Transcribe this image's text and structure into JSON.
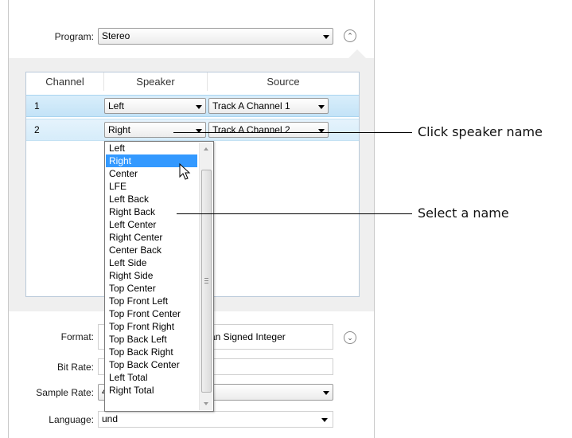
{
  "program": {
    "label": "Program:",
    "value": "Stereo",
    "collapse_icon": "chevron-up-icon"
  },
  "mapping": {
    "headers": [
      "Channel",
      "Speaker",
      "Source"
    ],
    "rows": [
      {
        "channel": "1",
        "speaker": "Left",
        "source": "Track A  Channel 1"
      },
      {
        "channel": "2",
        "speaker": "Right",
        "source": "Track A  Channel 2"
      }
    ]
  },
  "speaker_dropdown": {
    "selected": "Right",
    "options": [
      "Left",
      "Right",
      "Center",
      "LFE",
      "Left Back",
      "Right Back",
      "Left Center",
      "Right Center",
      "Center Back",
      "Left Side",
      "Right Side",
      "Top Center",
      "Top Front Left",
      "Top Front Center",
      "Top Front Right",
      "Top Back Left",
      "Top Back Right",
      "Top Back Center",
      "Left Total",
      "Right Total"
    ]
  },
  "format": {
    "label": "Format:",
    "value": "an Signed Integer",
    "expand_icon": "chevron-down-icon"
  },
  "bit_rate": {
    "label": "Bit Rate:",
    "value": ""
  },
  "sample_rate": {
    "label": "Sample Rate:",
    "value": "4"
  },
  "language": {
    "label": "Language:",
    "value": "und"
  },
  "callouts": {
    "click_speaker": "Click speaker name",
    "select_name": "Select a name"
  },
  "colors": {
    "selection": "#3399ff",
    "row_highlight": "#c3e3f7",
    "panel_bg": "#efefef"
  }
}
